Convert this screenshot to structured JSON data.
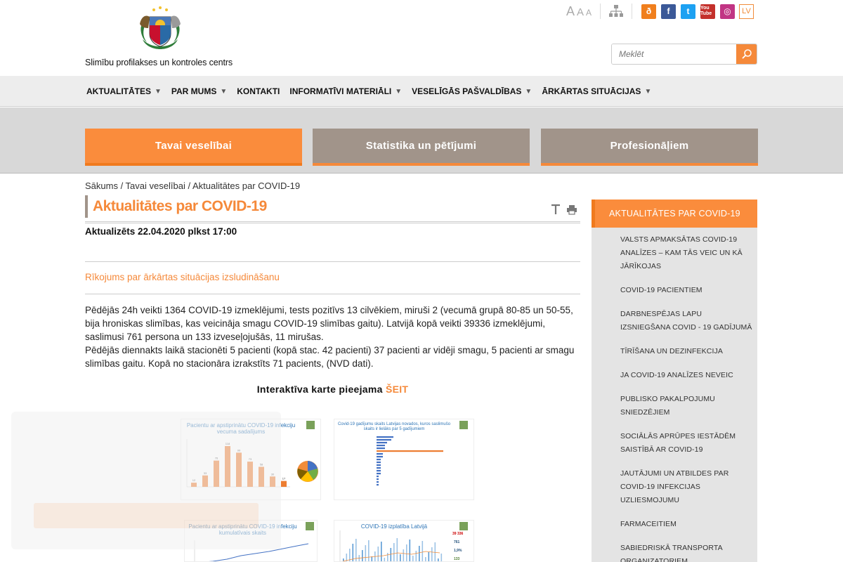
{
  "header": {
    "org_name": "Slimību profilakses un kontroles centrs",
    "font_sizes": [
      "A",
      "A",
      "A"
    ],
    "social": [
      {
        "name": "draugiem",
        "glyph": "ð"
      },
      {
        "name": "facebook",
        "glyph": "f"
      },
      {
        "name": "twitter",
        "glyph": "t"
      },
      {
        "name": "youtube",
        "glyph": "You Tube"
      },
      {
        "name": "instagram",
        "glyph": "◎"
      }
    ],
    "language": "LV",
    "search_placeholder": "Meklēt"
  },
  "nav": {
    "items": [
      {
        "label": "AKTUALITĀTES",
        "has_menu": true
      },
      {
        "label": "PAR MUMS",
        "has_menu": true
      },
      {
        "label": "KONTAKTI",
        "has_menu": false
      },
      {
        "label": "INFORMATĪVI MATERIĀLI",
        "has_menu": true
      },
      {
        "label": "VESELĪGĀS PAŠVALDĪBAS",
        "has_menu": true
      },
      {
        "label": "ĀRKĀRTAS SITUĀCIJAS",
        "has_menu": true
      }
    ],
    "caret": "▼"
  },
  "tabs": [
    {
      "label": "Tavai veselībai",
      "active": true
    },
    {
      "label": "Statistika un pētījumi",
      "active": false
    },
    {
      "label": "Profesionāļiem",
      "active": false
    }
  ],
  "breadcrumb": "Sākums / Tavai veselībai / Aktualitātes par COVID-19",
  "page": {
    "title": "Aktualitātes par COVID-19",
    "updated": "Aktualizēts 22.04.2020 plkst 17:00",
    "order_link": "Rīkojums par ārkārtas situācijas izsludināšanu",
    "paragraph1": "Pēdējās 24h veikti 1364 COVID-19 izmeklējumi, tests pozitīvs 13 cilvēkiem, miruši 2 (vecumā grupā 80-85 un 50-55, bija hroniskas slimības, kas veicināja smagu COVID-19 slimības gaitu). Latvijā kopā veikti 39336 izmeklējumi, saslimusi 761 persona un 133 izveseļojušās, 11 mirušas.",
    "paragraph2": "Pēdējās diennakts laikā stacionēti 5 pacienti (kopā stac. 42 pacienti) 37 pacienti ar vidēji smagu, 5 pacienti ar smagu slimības gaitu. Kopā no stacionāra izrakstīts 71 pacients, (NVD dati).",
    "map_text": "Interaktīva karte pieejama",
    "map_link": "ŠEIT"
  },
  "thumbnails": {
    "age_chart_title": "Pacientu ar apstiprinātu COVID-19 infekciju vecuma sadalījums",
    "age_chart_values": [
      "12",
      "33",
      "76",
      "118",
      "99",
      "73",
      "58",
      "30",
      "17"
    ],
    "regions_chart_title": "Covid-19 gadījumu skaits Latvijas novados, kuros saslimušo skaits ir lielāks par 5 gadījumiem",
    "cumulative_chart_title": "Pacientu ar apstiprinātu COVID-19 infekciju kumulatīvais skaits",
    "spread_chart_title": "COVID-19 izplatība Latvijā",
    "spread_stats": [
      "39 336",
      "761",
      "1,9%",
      "133"
    ]
  },
  "sidebar": {
    "heading": "AKTUALITĀTES PAR COVID-19",
    "items": [
      "Valsts apmaksātas COVID-19 analīzes – kam tās veic un kā jārīkojas",
      "COVID-19 pacientiem",
      "Darbnespējas lapu izsniegšana COVID - 19 gadījumā",
      "Tīrīšana un dezinfekcija",
      "Ja COVID-19 analīzes neveic",
      "Publisko pakalpojumu sniedzējiem",
      "Sociālās aprūpes iestādēm saistībā ar COVID-19",
      "Jautājumi un atbildes par COVID-19 infekcijas uzliesmojumu",
      "Farmaceitiem",
      "Sabiedriskā transporta organizatoriem"
    ]
  },
  "colors": {
    "accent_orange": "#f5893a",
    "tab_gray": "#a1948a",
    "nav_bg": "#ededed",
    "band_bg": "#d8d8d8"
  }
}
